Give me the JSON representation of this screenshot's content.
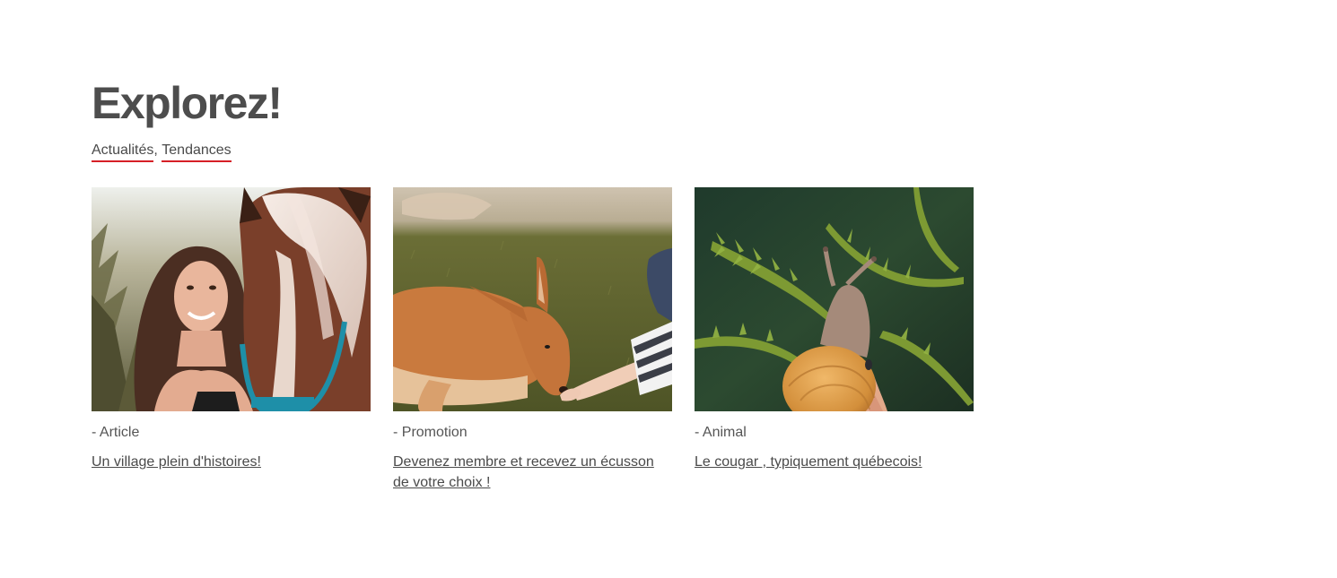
{
  "section": {
    "title": "Explorez!",
    "tags": [
      {
        "label": "Actualités"
      },
      {
        "label": "Tendances"
      }
    ],
    "tag_separator": ",",
    "accent_color": "#d61f26"
  },
  "cards": [
    {
      "image": "girl-with-horse-photo",
      "category": "- Article",
      "link": "Un village plein d'histoires!"
    },
    {
      "image": "kangaroo-eating-from-hand-photo",
      "category": "- Promotion",
      "link": "Devenez membre et recevez un écusson de votre choix !"
    },
    {
      "image": "snail-on-hand-ferns-photo",
      "category": "- Animal",
      "link": "Le cougar , typiquement québecois!"
    }
  ]
}
